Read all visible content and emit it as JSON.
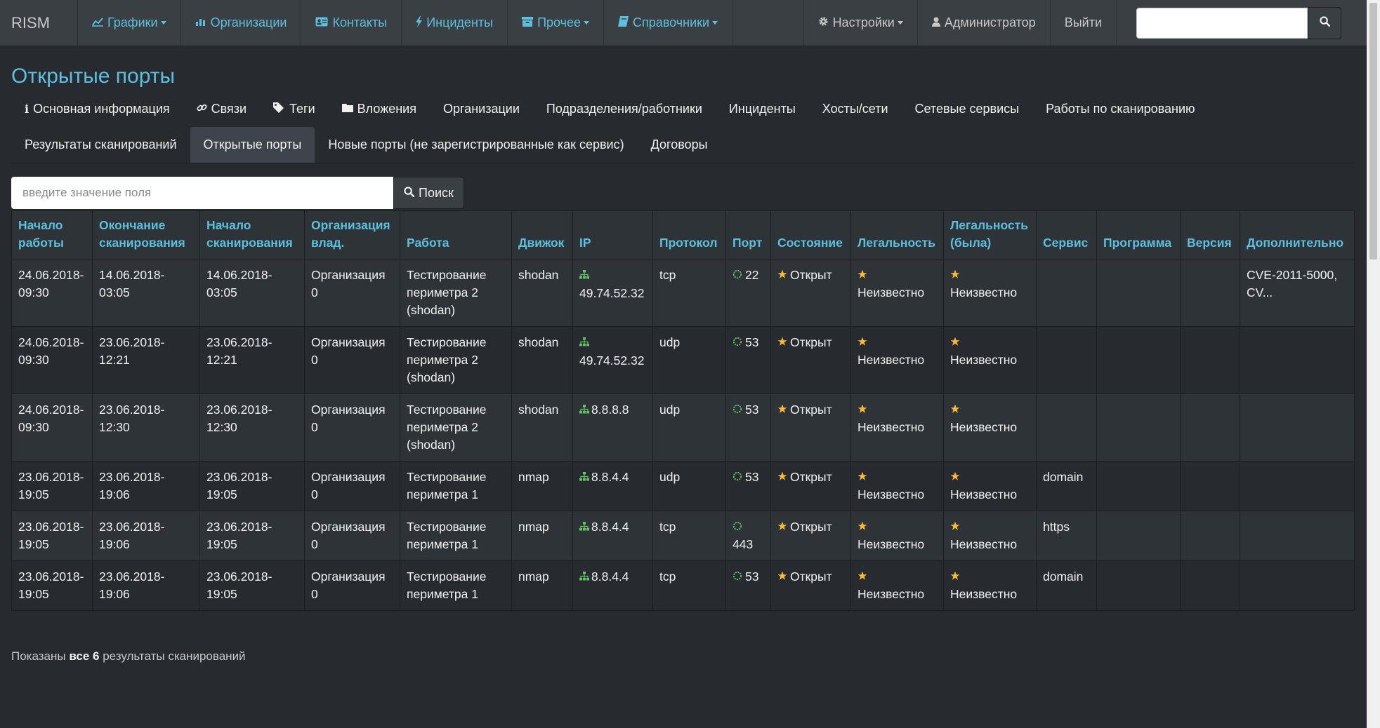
{
  "navbar": {
    "brand": "RISM",
    "items": [
      {
        "label": "Графики",
        "icon": "line-chart-icon",
        "dropdown": true
      },
      {
        "label": "Организации",
        "icon": "bar-chart-icon",
        "dropdown": false
      },
      {
        "label": "Контакты",
        "icon": "address-card-icon",
        "dropdown": false
      },
      {
        "label": "Инциденты",
        "icon": "bolt-icon",
        "dropdown": false
      },
      {
        "label": "Прочее",
        "icon": "archive-icon",
        "dropdown": true
      },
      {
        "label": "Справочники",
        "icon": "book-icon",
        "dropdown": true
      }
    ],
    "settings_label": "Настройки",
    "user_label": "Администратор",
    "logout_label": "Выйти",
    "search_value": ""
  },
  "page": {
    "title": "Открытые порты"
  },
  "tabs": {
    "row1": [
      {
        "label": "Основная информация",
        "icon": "info-icon"
      },
      {
        "label": "Связи",
        "icon": "link-icon"
      },
      {
        "label": "Теги",
        "icon": "tags-icon"
      },
      {
        "label": "Вложения",
        "icon": "folder-icon"
      },
      {
        "label": "Организации",
        "icon": ""
      },
      {
        "label": "Подразделения/работники",
        "icon": ""
      },
      {
        "label": "Инциденты",
        "icon": ""
      },
      {
        "label": "Хосты/сети",
        "icon": ""
      },
      {
        "label": "Сетевые сервисы",
        "icon": ""
      },
      {
        "label": "Работы по сканированию",
        "icon": ""
      }
    ],
    "row2": [
      {
        "label": "Результаты сканирований",
        "active": false
      },
      {
        "label": "Открытые порты",
        "active": true
      },
      {
        "label": "Новые порты (не зарегистрированные как сервис)",
        "active": false
      },
      {
        "label": "Договоры",
        "active": false
      }
    ]
  },
  "search": {
    "placeholder": "введите значение поля",
    "button_label": "Поиск"
  },
  "table": {
    "headers": [
      "Начало работы",
      "Окончание сканирования",
      "Начало сканирования",
      "Организация влад.",
      "Работа",
      "Движок",
      "IP",
      "Протокол",
      "Порт",
      "Состояние",
      "Легальность",
      "Легальность (была)",
      "Сервис",
      "Программа",
      "Версия",
      "Дополнительно"
    ],
    "rows": [
      {
        "start": "24.06.2018-09:30",
        "scan_end": "14.06.2018-03:05",
        "scan_start": "14.06.2018-03:05",
        "org": "Организация 0",
        "job": "Тестирование периметра 2 (shodan)",
        "engine": "shodan",
        "ip": "49.74.52.32",
        "proto": "tcp",
        "port": "22",
        "state": "Открыт",
        "legal": "Неизвестно",
        "legal_was": "Неизвестно",
        "service": "",
        "program": "",
        "version": "",
        "extra": "CVE-2011-5000, CV..."
      },
      {
        "start": "24.06.2018-09:30",
        "scan_end": "23.06.2018-12:21",
        "scan_start": "23.06.2018-12:21",
        "org": "Организация 0",
        "job": "Тестирование периметра 2 (shodan)",
        "engine": "shodan",
        "ip": "49.74.52.32",
        "proto": "udp",
        "port": "53",
        "state": "Открыт",
        "legal": "Неизвестно",
        "legal_was": "Неизвестно",
        "service": "",
        "program": "",
        "version": "",
        "extra": ""
      },
      {
        "start": "24.06.2018-09:30",
        "scan_end": "23.06.2018-12:30",
        "scan_start": "23.06.2018-12:30",
        "org": "Организация 0",
        "job": "Тестирование периметра 2 (shodan)",
        "engine": "shodan",
        "ip": "8.8.8.8",
        "proto": "udp",
        "port": "53",
        "state": "Открыт",
        "legal": "Неизвестно",
        "legal_was": "Неизвестно",
        "service": "",
        "program": "",
        "version": "",
        "extra": ""
      },
      {
        "start": "23.06.2018-19:05",
        "scan_end": "23.06.2018-19:06",
        "scan_start": "23.06.2018-19:05",
        "org": "Организация 0",
        "job": "Тестирование периметра 1",
        "engine": "nmap",
        "ip": "8.8.4.4",
        "proto": "udp",
        "port": "53",
        "state": "Открыт",
        "legal": "Неизвестно",
        "legal_was": "Неизвестно",
        "service": "domain",
        "program": "",
        "version": "",
        "extra": ""
      },
      {
        "start": "23.06.2018-19:05",
        "scan_end": "23.06.2018-19:06",
        "scan_start": "23.06.2018-19:05",
        "org": "Организация 0",
        "job": "Тестирование периметра 1",
        "engine": "nmap",
        "ip": "8.8.4.4",
        "proto": "tcp",
        "port": "443",
        "state": "Открыт",
        "legal": "Неизвестно",
        "legal_was": "Неизвестно",
        "service": "https",
        "program": "",
        "version": "",
        "extra": ""
      },
      {
        "start": "23.06.2018-19:05",
        "scan_end": "23.06.2018-19:06",
        "scan_start": "23.06.2018-19:05",
        "org": "Организация 0",
        "job": "Тестирование периметра 1",
        "engine": "nmap",
        "ip": "8.8.4.4",
        "proto": "tcp",
        "port": "53",
        "state": "Открыт",
        "legal": "Неизвестно",
        "legal_was": "Неизвестно",
        "service": "domain",
        "program": "",
        "version": "",
        "extra": ""
      }
    ]
  },
  "footer": {
    "prefix": "Показаны",
    "count": "все 6",
    "suffix": "результаты сканирований"
  },
  "colors": {
    "accent": "#5bc0de",
    "star": "#f8b930",
    "success": "#62c462",
    "background": "#272b30"
  }
}
